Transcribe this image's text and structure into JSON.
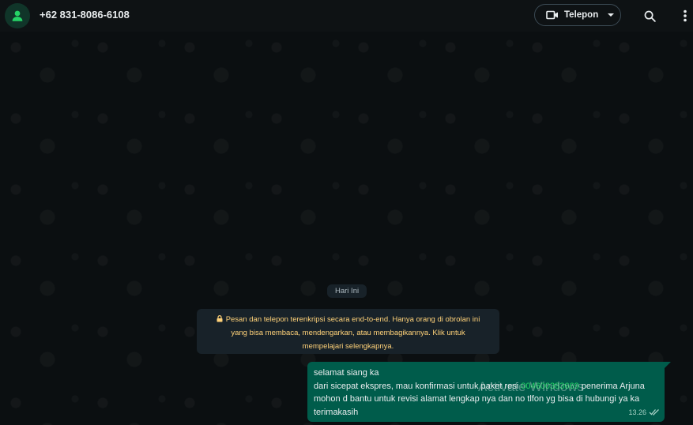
{
  "header": {
    "contact_name": "+62 831-8086-6108",
    "call_label": "Telepon"
  },
  "chat": {
    "date_chip": "Hari Ini",
    "encryption_notice": [
      "Pesan dan telepon terenkripsi secara end-to-end. Hanya orang di obrolan ini",
      "yang bisa membaca, mendengarkan, atau membagikannya. Klik untuk",
      "mempelajari selengkapnya."
    ],
    "message": {
      "line1": "selamat siang ka",
      "line2_before": "dari sicepat ekspres, mau konfirmasi untuk paket resi ",
      "resi": "004600383669",
      "line2_after": " penerima Arjuna",
      "line3": "mohon d bantu untuk revisi alamat lengkap nya dan no tlfon yg bisa di hubungi ya ka",
      "line4": "terimakasih",
      "time": "13.26"
    }
  },
  "watermark": "Activate Windows",
  "colors": {
    "bubble": "#005c4b",
    "accent_green": "#25d366",
    "notice_text": "#ffd279",
    "background": "#0b0f11"
  },
  "icons": [
    "person-icon",
    "video-camera-icon",
    "chevron-down-icon",
    "search-icon",
    "more-vertical-icon",
    "lock-icon",
    "double-check-icon"
  ]
}
